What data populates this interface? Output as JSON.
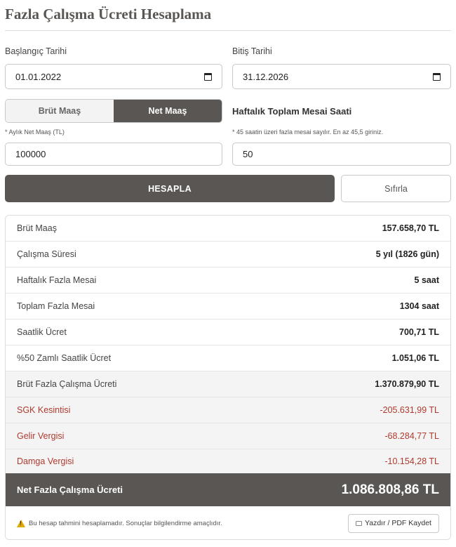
{
  "page": {
    "title": "Fazla Çalışma Ücreti Hesaplama"
  },
  "form": {
    "start_label": "Başlangıç Tarihi",
    "start_value": "01.01.2022",
    "end_label": "Bitiş Tarihi",
    "end_value": "31.12.2026",
    "toggle": {
      "gross": "Brüt Maaş",
      "net": "Net Maaş",
      "selected": "net"
    },
    "salary_hint": "* Aylık Net Maaş (TL)",
    "salary_value": "100000",
    "weekly_title": "Haftalık Toplam Mesai Saati",
    "weekly_hint": "* 45 saatin üzeri fazla mesai sayılır. En az 45,5 giriniz.",
    "weekly_value": "50"
  },
  "actions": {
    "calculate": "HESAPLA",
    "reset": "Sıfırla"
  },
  "results": {
    "rows": [
      {
        "label": "Brüt Maaş",
        "value": "157.658,70 TL"
      },
      {
        "label": "Çalışma Süresi",
        "value": "5 yıl (1826 gün)"
      },
      {
        "label": "Haftalık Fazla Mesai",
        "value": "5 saat"
      },
      {
        "label": "Toplam Fazla Mesai",
        "value": "1304 saat"
      },
      {
        "label": "Saatlik Ücret",
        "value": "700,71 TL"
      },
      {
        "label": "%50 Zamlı Saatlik Ücret",
        "value": "1.051,06 TL"
      },
      {
        "label": "Brüt Fazla Çalışma Ücreti",
        "value": "1.370.879,90 TL"
      },
      {
        "label": "SGK Kesintisi",
        "value": "-205.631,99 TL"
      },
      {
        "label": "Gelir Vergisi",
        "value": "-68.284,77 TL"
      },
      {
        "label": "Damga Vergisi",
        "value": "-10.154,28 TL"
      }
    ],
    "net_label": "Net Fazla Çalışma Ücreti",
    "net_value": "1.086.808,86 TL",
    "disclaimer": "Bu hesap tahmini hesaplamadır. Sonuçlar bilgilendirme amaçlıdır.",
    "print_label": "Yazdır / PDF Kaydet"
  },
  "colors": {
    "primary": "#5a5653",
    "deduction": "#b03a2e",
    "warning": "#e0a800"
  },
  "icons": {
    "date": "calendar-icon",
    "warning": "warning-icon",
    "print": "print-icon"
  }
}
